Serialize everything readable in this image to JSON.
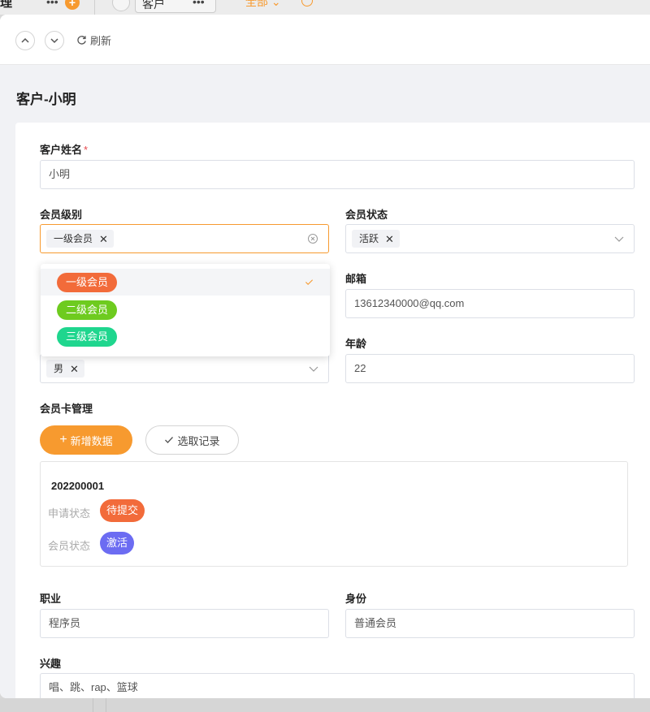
{
  "background": {
    "title": "理",
    "tab_label": "客户",
    "filter_label": "全部"
  },
  "toolbar": {
    "refresh_label": "刷新"
  },
  "page": {
    "title": "客户-小明"
  },
  "form": {
    "name": {
      "label": "客户姓名",
      "required_mark": "*",
      "value": "小明"
    },
    "member_level": {
      "label": "会员级别",
      "selected_tag": "一级会员"
    },
    "member_status": {
      "label": "会员状态",
      "selected_tag": "活跃"
    },
    "email": {
      "label": "邮箱",
      "value": "13612340000@qq.com"
    },
    "gender": {
      "selected_tag": "男"
    },
    "age": {
      "label": "年龄",
      "value": "22"
    },
    "card_management": {
      "label": "会员卡管理",
      "add_button": "新增数据",
      "select_button": "选取记录"
    },
    "record": {
      "id": "202200001",
      "apply_status_label": "申请状态",
      "apply_status_value": "待提交",
      "member_status_label": "会员状态",
      "member_status_value": "激活"
    },
    "occupation": {
      "label": "职业",
      "value": "程序员"
    },
    "identity": {
      "label": "身份",
      "value": "普通会员"
    },
    "hobbies": {
      "label": "兴趣",
      "value": "唱、跳、rap、篮球"
    }
  },
  "dropdown": {
    "options": [
      {
        "label": "一级会员",
        "color": "#f26b3a",
        "selected": true
      },
      {
        "label": "二级会员",
        "color": "#6ecb1f",
        "selected": false
      },
      {
        "label": "三级会员",
        "color": "#1fd68e",
        "selected": false
      }
    ]
  },
  "colors": {
    "accent": "#f79a2f",
    "apply_status_badge": "#f26b3a",
    "member_status_badge": "#6c6cf2"
  }
}
